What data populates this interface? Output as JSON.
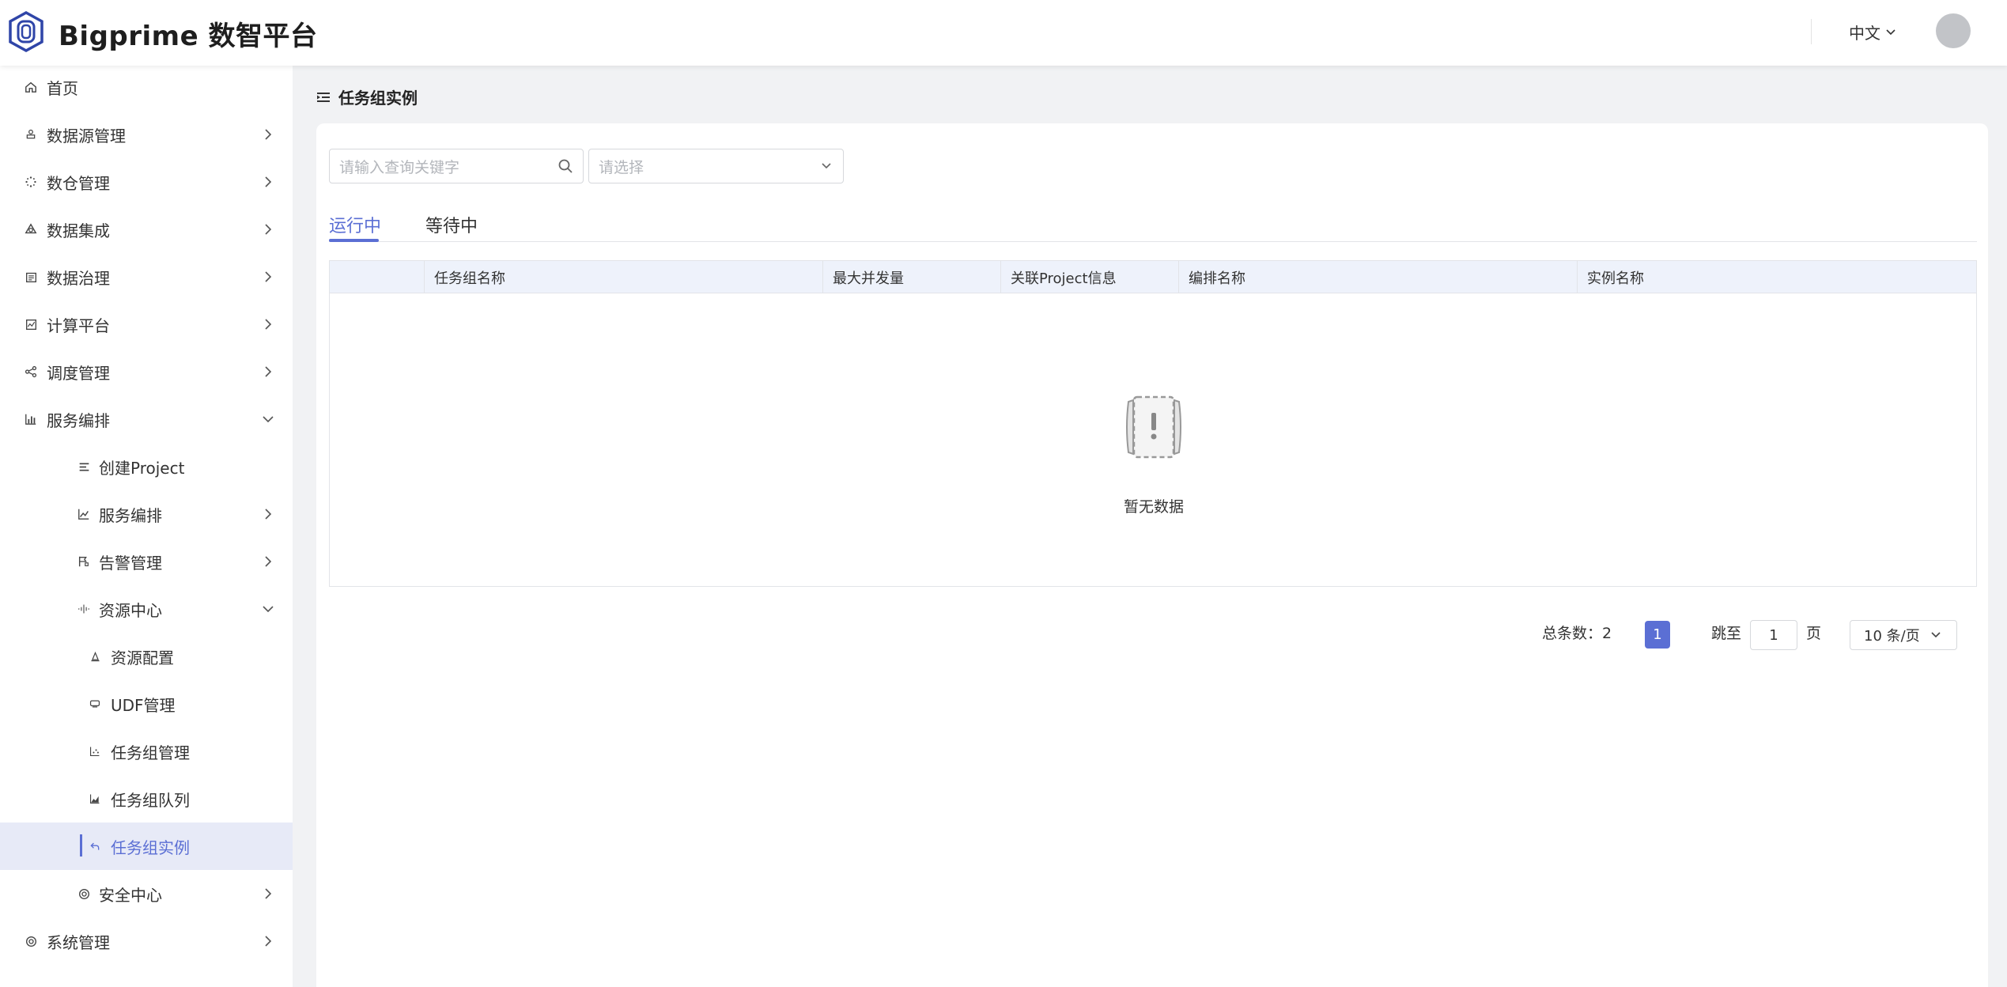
{
  "header": {
    "brand": "Bigprime 数智平台",
    "language": "中文"
  },
  "sidebar": {
    "items": [
      {
        "label": "首页",
        "icon": "home-icon",
        "level": 0,
        "chevron": "none"
      },
      {
        "label": "数据源管理",
        "icon": "datasource-icon",
        "level": 0,
        "chevron": "right"
      },
      {
        "label": "数仓管理",
        "icon": "warehouse-icon",
        "level": 0,
        "chevron": "right"
      },
      {
        "label": "数据集成",
        "icon": "integration-icon",
        "level": 0,
        "chevron": "right"
      },
      {
        "label": "数据治理",
        "icon": "governance-icon",
        "level": 0,
        "chevron": "right"
      },
      {
        "label": "计算平台",
        "icon": "compute-icon",
        "level": 0,
        "chevron": "right"
      },
      {
        "label": "调度管理",
        "icon": "schedule-icon",
        "level": 0,
        "chevron": "right"
      },
      {
        "label": "服务编排",
        "icon": "bar-chart-icon",
        "level": 0,
        "chevron": "down"
      },
      {
        "label": "创建Project",
        "icon": "list-icon",
        "level": 1,
        "chevron": "none"
      },
      {
        "label": "服务编排",
        "icon": "line-chart-icon",
        "level": 1,
        "chevron": "right"
      },
      {
        "label": "告警管理",
        "icon": "flag-icon",
        "level": 1,
        "chevron": "right"
      },
      {
        "label": "资源中心",
        "icon": "resource-icon",
        "level": 1,
        "chevron": "down"
      },
      {
        "label": "资源配置",
        "icon": "config-icon",
        "level": 2,
        "chevron": "none"
      },
      {
        "label": "UDF管理",
        "icon": "udf-icon",
        "level": 2,
        "chevron": "none"
      },
      {
        "label": "任务组管理",
        "icon": "scatter-icon",
        "level": 2,
        "chevron": "none"
      },
      {
        "label": "任务组队列",
        "icon": "area-chart-icon",
        "level": 2,
        "chevron": "none"
      },
      {
        "label": "任务组实例",
        "icon": "undo-icon",
        "level": 2,
        "chevron": "none",
        "active": true
      },
      {
        "label": "安全中心",
        "icon": "shield-icon",
        "level": 1,
        "chevron": "right"
      },
      {
        "label": "系统管理",
        "icon": "settings-icon",
        "level": 0,
        "chevron": "right"
      }
    ]
  },
  "breadcrumb": {
    "title": "任务组实例"
  },
  "filters": {
    "search_placeholder": "请输入查询关键字",
    "select_placeholder": "请选择"
  },
  "tabs": [
    {
      "label": "运行中",
      "active": true
    },
    {
      "label": "等待中",
      "active": false
    }
  ],
  "table": {
    "columns": [
      "",
      "任务组名称",
      "最大并发量",
      "关联Project信息",
      "编排名称",
      "实例名称"
    ],
    "rows": [],
    "empty_text": "暂无数据"
  },
  "pagination": {
    "total_label": "总条数：2",
    "current_page": "1",
    "jump_label": "跳至",
    "jump_value": "1",
    "page_unit": "页",
    "page_size": "10 条/页"
  },
  "colors": {
    "accent": "#5b6fd4",
    "active_bg": "#e7eaf7",
    "table_header_bg": "#eef2fb"
  }
}
